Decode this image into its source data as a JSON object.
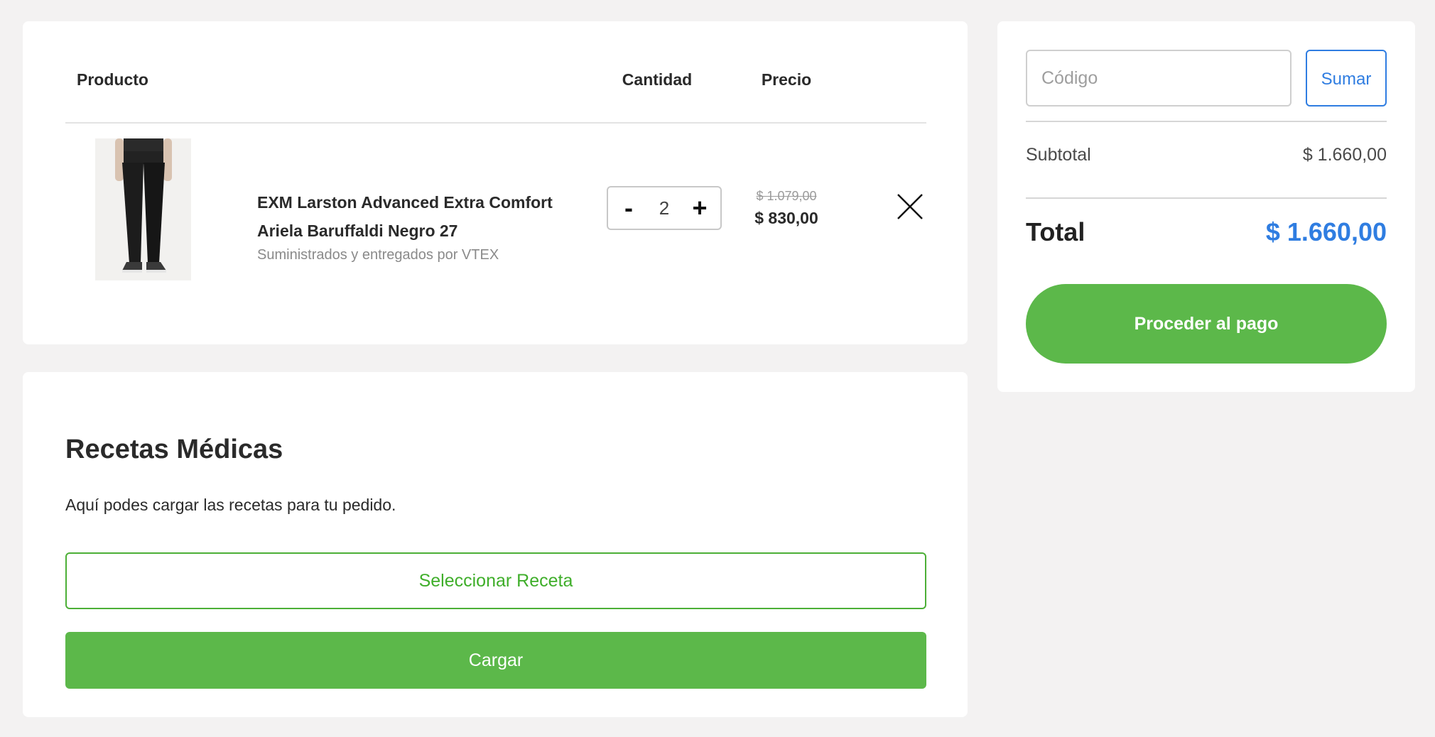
{
  "cart": {
    "headers": {
      "product": "Producto",
      "quantity": "Cantidad",
      "price": "Precio"
    },
    "items": [
      {
        "name_line1": "EXM Larston Advanced Extra Comfort",
        "name_line2": "Ariela Baruffaldi Negro 27",
        "seller": "Suministrados y entregados por VTEX",
        "quantity": "2",
        "decrement_label": "-",
        "increment_label": "+",
        "price_original": "$ 1.079,00",
        "price_current": "$ 830,00",
        "image_icon": "jeans-product-image",
        "remove_icon": "close-icon"
      }
    ]
  },
  "prescriptions": {
    "title": "Recetas Médicas",
    "description": "Aquí podes cargar las recetas para tu pedido.",
    "select_label": "Seleccionar Receta",
    "upload_label": "Cargar"
  },
  "summary": {
    "coupon_placeholder": "Código",
    "coupon_value": "",
    "apply_label": "Sumar",
    "subtotal_label": "Subtotal",
    "subtotal_value": "$ 1.660,00",
    "total_label": "Total",
    "total_value": "$ 1.660,00",
    "checkout_label": "Proceder al pago"
  },
  "colors": {
    "accent_green": "#5cb84a",
    "accent_blue": "#2f7de1",
    "background": "#f3f2f2"
  }
}
